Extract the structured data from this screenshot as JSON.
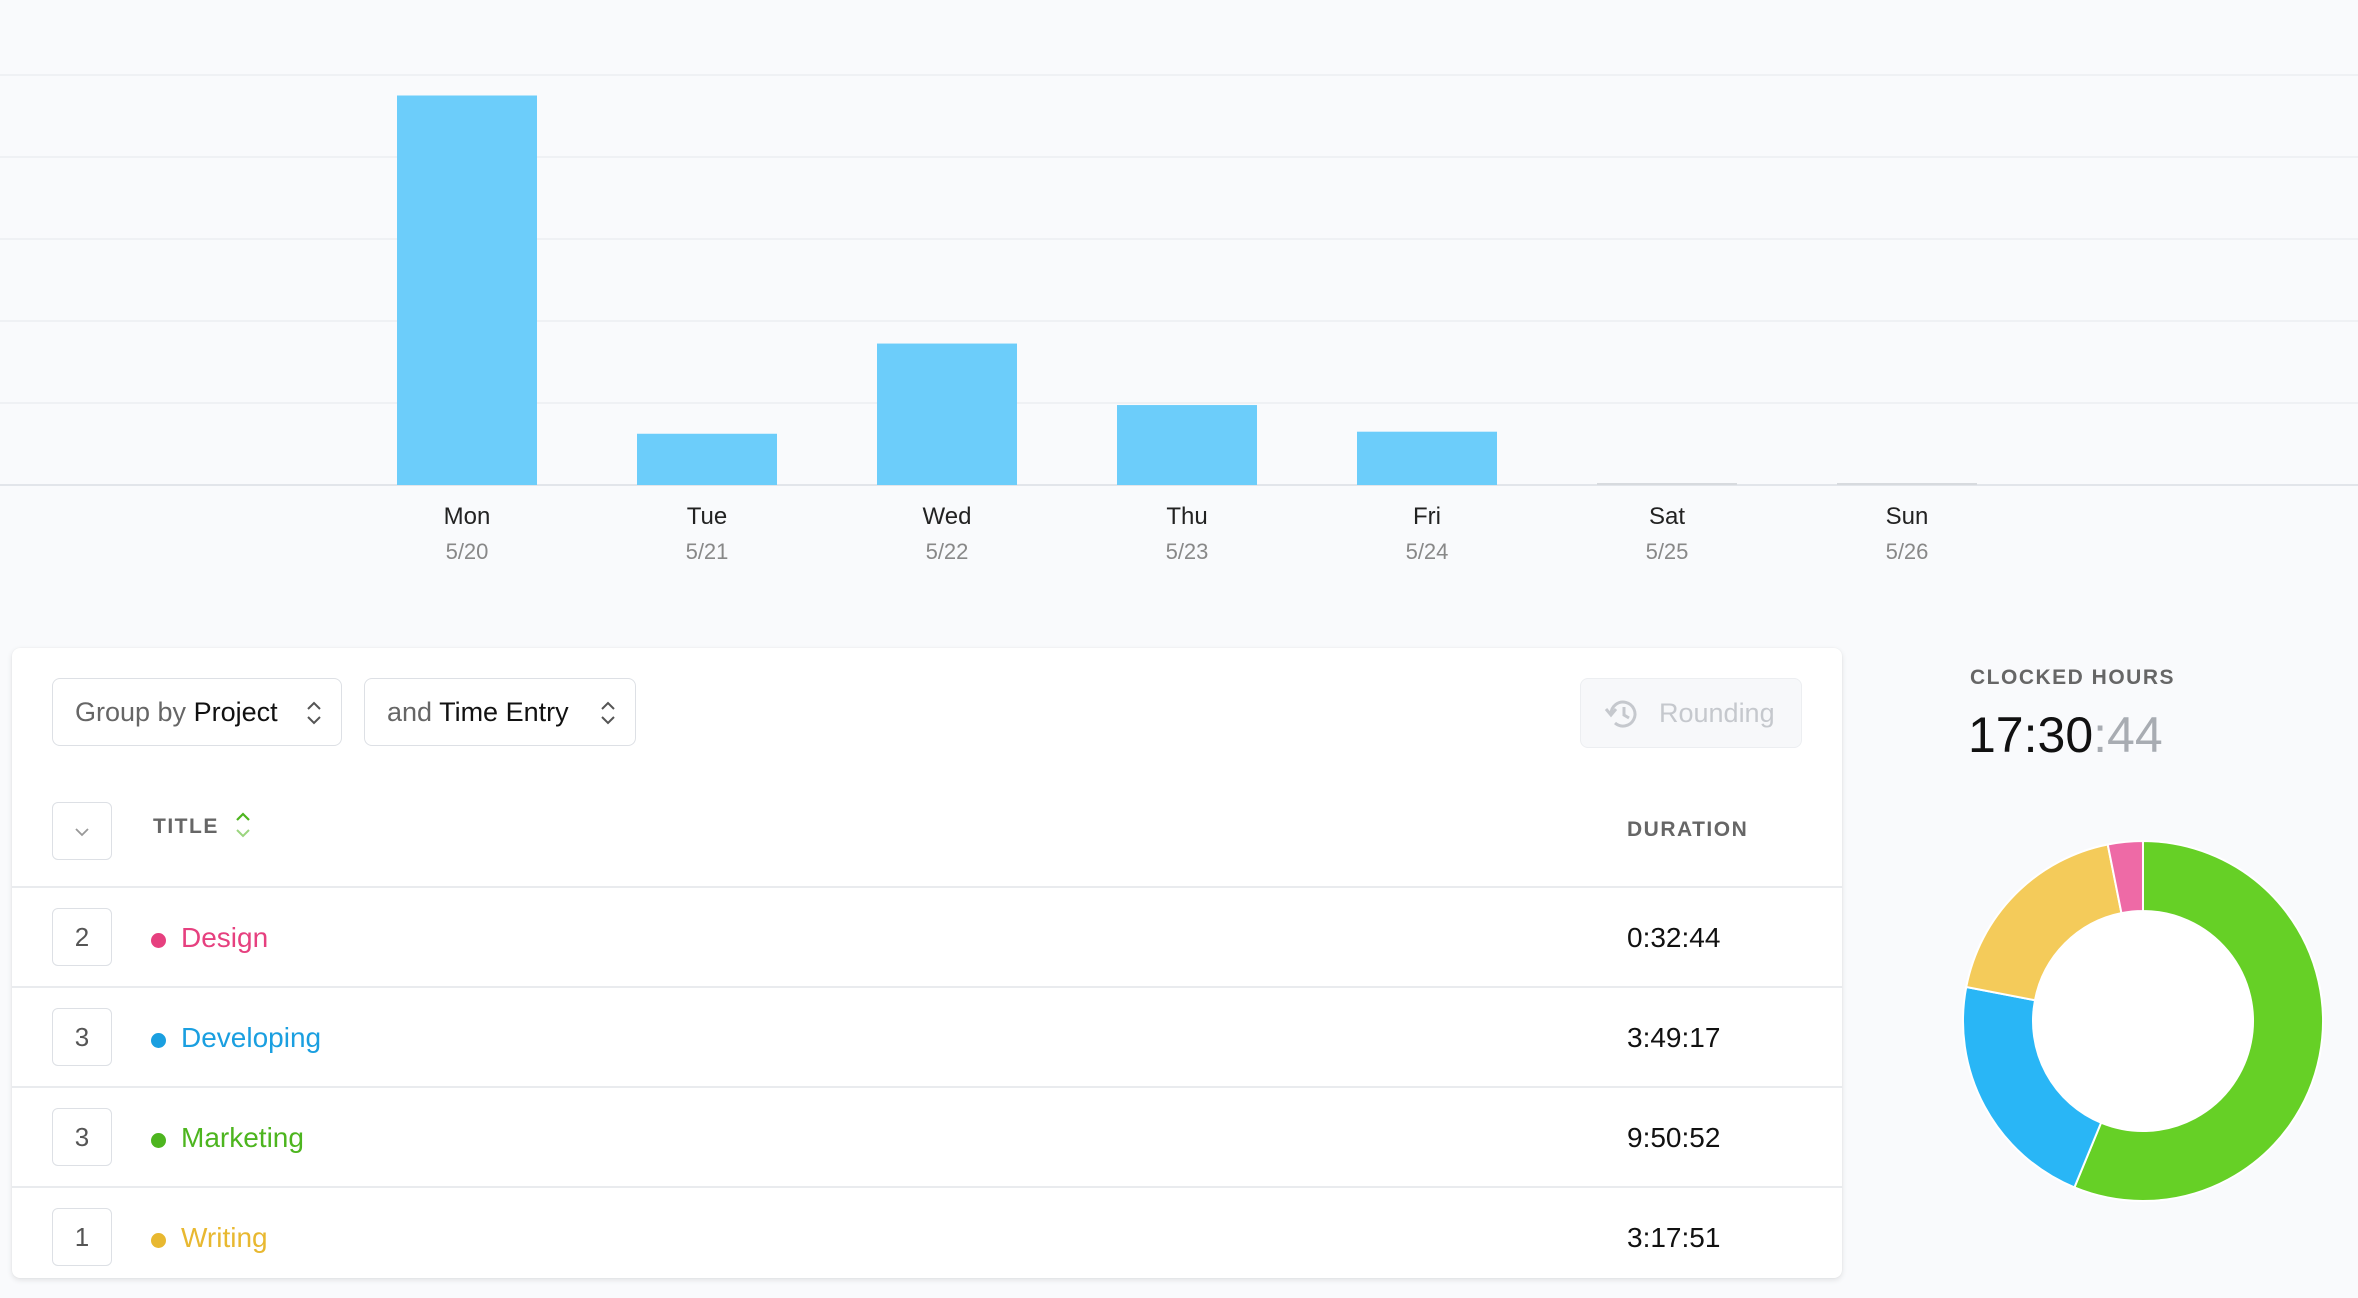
{
  "chart_data": {
    "type": "bar",
    "categories": [
      "Mon",
      "Tue",
      "Wed",
      "Thu",
      "Fri",
      "Sat",
      "Sun"
    ],
    "dates": [
      "5/20",
      "5/21",
      "5/22",
      "5/23",
      "5/24",
      "5/25",
      "5/26"
    ],
    "values": [
      9.5,
      1.25,
      3.45,
      1.95,
      1.3,
      0,
      0
    ],
    "ylim": [
      0,
      10
    ],
    "grid": true,
    "color": "#6ccdfa"
  },
  "report": {
    "group_by": {
      "prefix": "Group by",
      "value": "Project"
    },
    "then_by": {
      "prefix": "and",
      "value": "Time Entry"
    },
    "rounding_label": "Rounding",
    "columns": {
      "title": "TITLE",
      "duration": "DURATION"
    },
    "rows": [
      {
        "count": "2",
        "name": "Design",
        "color": "#e6407f",
        "duration": "0:32:44"
      },
      {
        "count": "3",
        "name": "Developing",
        "color": "#1a9fe0",
        "duration": "3:49:17"
      },
      {
        "count": "3",
        "name": "Marketing",
        "color": "#4db51f",
        "duration": "9:50:52"
      },
      {
        "count": "1",
        "name": "Writing",
        "color": "#e8b830",
        "duration": "3:17:51"
      }
    ]
  },
  "summary": {
    "label": "CLOCKED HOURS",
    "hours_minutes": "17:30",
    "seconds": ":44",
    "donut": [
      {
        "name": "Marketing",
        "value": 9.85,
        "color": "#66d026"
      },
      {
        "name": "Developing",
        "value": 3.82,
        "color": "#29b6f6"
      },
      {
        "name": "Writing",
        "value": 3.3,
        "color": "#f4cb5a"
      },
      {
        "name": "Design",
        "value": 0.55,
        "color": "#ee6aa6"
      }
    ]
  }
}
